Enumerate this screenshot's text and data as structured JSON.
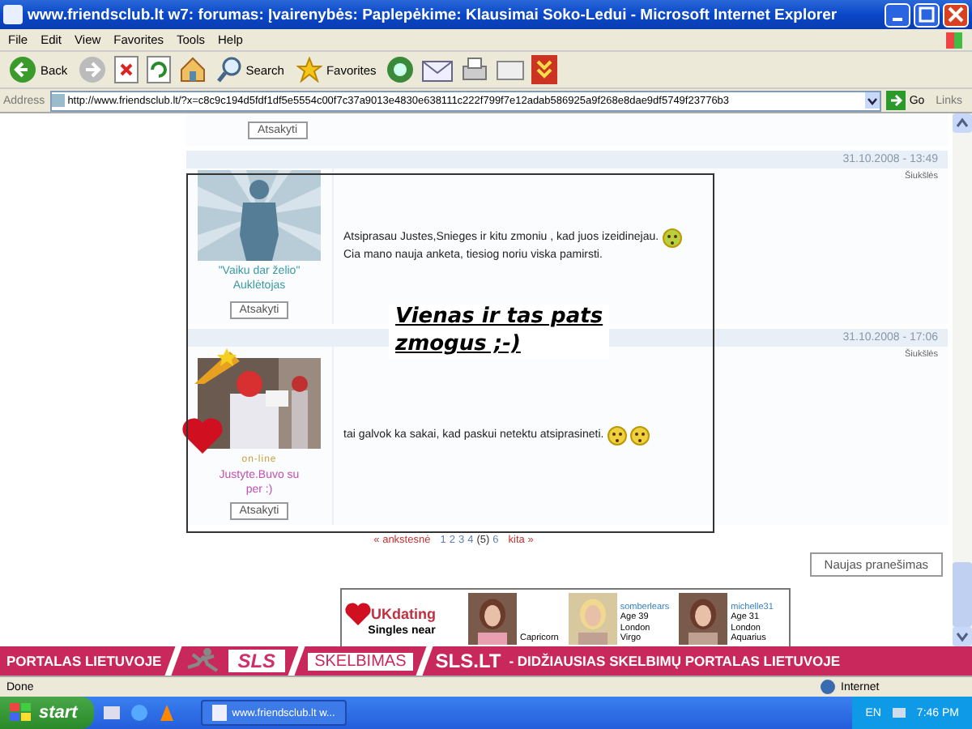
{
  "window": {
    "title": "www.friendsclub.lt w7: forumas: Įvairenybės: Paplepėkime: Klausimai Soko-Ledui - Microsoft Internet Explorer"
  },
  "menu": [
    "File",
    "Edit",
    "View",
    "Favorites",
    "Tools",
    "Help"
  ],
  "toolbar": {
    "back": "Back",
    "search": "Search",
    "favorites": "Favorites"
  },
  "address": {
    "label": "Address",
    "url": "http://www.friendsclub.lt/?x=c8c9c194d5fdf1df5e5554c00f7c37a9013e4830e638111c222f799f7e12adab586925a9f268e8dae9df5749f23776b3",
    "go": "Go",
    "links": "Links"
  },
  "top_reply": "Atsakyti",
  "posts": [
    {
      "date": "31.10.2008 - 13:49",
      "trash": "Šiukšlės",
      "kind": "silhouette",
      "author": "\"Vaiku dar želio\" Auklėtojas",
      "reply": "Atsakyti",
      "lines": [
        "Atsiprasau Justes,Snieges ir kitu zmoniu , kad juos izeidinejau.",
        "Cia mano nauja anketa, tiesiog noriu viska pamirsti."
      ],
      "smileys": [
        {
          "kind": "sick"
        }
      ]
    },
    {
      "date": "31.10.2008 - 17:06",
      "trash": "Šiukšlės",
      "author": "Justyte.Buvo su per :)",
      "online": "on-line",
      "reply": "Atsakyti",
      "lines": [
        "tai galvok ka sakai, kad paskui netektu atsiprasineti."
      ],
      "smileys": [
        {
          "kind": "blush"
        },
        {
          "kind": "blush"
        }
      ]
    }
  ],
  "overlay_text": [
    "Vienas ir tas pats",
    "zmogus ;-)"
  ],
  "pagination": {
    "prev": "« ankstesnė",
    "pages": [
      {
        "label": "1",
        "selected": false
      },
      {
        "label": "2",
        "selected": false
      },
      {
        "label": "3",
        "selected": false
      },
      {
        "label": "4",
        "selected": false
      },
      {
        "label": "(5)",
        "selected": true
      },
      {
        "label": "6",
        "selected": false
      }
    ],
    "next": "kita »"
  },
  "new_post": "Naujas pranešimas",
  "ad": {
    "brand": "UKdating",
    "tagline": "Singles near",
    "profiles": [
      {
        "lines": [
          "Capricorn"
        ]
      },
      {
        "lines": [
          "somberlears",
          "Age 39",
          "London",
          "Virgo"
        ]
      },
      {
        "lines": [
          "michelle31",
          "Age 31",
          "London",
          "Aquarius"
        ]
      }
    ]
  },
  "banner": {
    "left": "PORTALAS LIETUVOJE",
    "logo": "SLS",
    "middle": "SKELBIMAS",
    "site": "SLS.LT",
    "slogan": "- DIDŽIAUSIAS SKELBIMŲ PORTALAS LIETUVOJE"
  },
  "status_bar": {
    "text": "Done",
    "zone": "Internet"
  },
  "taskbar": {
    "start": "start",
    "task": "www.friendsclub.lt w...",
    "lang": "EN",
    "time": "7:46 PM"
  }
}
